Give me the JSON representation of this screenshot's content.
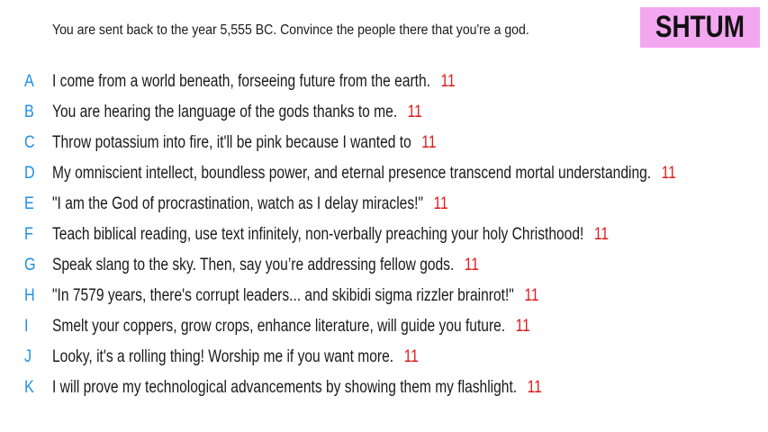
{
  "prompt": "You are sent back to the year 5,555 BC. Convince the people there that you're a god.",
  "brand": {
    "label": "SHTUM",
    "color": "#f4a7f1"
  },
  "colors": {
    "letter": "#1e8fe6",
    "score": "#e01b1b",
    "text": "#1a1a1a"
  },
  "answers": [
    {
      "letter": "A",
      "text": "I come from a world beneath, forseeing future from the earth.",
      "score": "11"
    },
    {
      "letter": "B",
      "text": "You are hearing the language of the gods thanks to me.",
      "score": "11"
    },
    {
      "letter": "C",
      "text": "Throw potassium into fire, it'll be pink because I wanted to",
      "score": "11"
    },
    {
      "letter": "D",
      "text": "My omniscient intellect, boundless power, and eternal presence transcend mortal understanding.",
      "score": "11"
    },
    {
      "letter": "E",
      "text": "\"I am the God of procrastination, watch as I delay miracles!\"",
      "score": "11"
    },
    {
      "letter": "F",
      "text": "Teach biblical reading, use text infinitely, non-verbally preaching your holy Christhood!",
      "score": "11"
    },
    {
      "letter": "G",
      "text": "Speak slang to the sky. Then, say you’re addressing fellow gods.",
      "score": "11"
    },
    {
      "letter": "H",
      "text": "\"In 7579 years, there's corrupt leaders... and skibidi sigma rizzler brainrot!\"",
      "score": "11"
    },
    {
      "letter": "I",
      "text": "Smelt your coppers, grow crops, enhance literature, will guide you future.",
      "score": "11"
    },
    {
      "letter": "J",
      "text": "Looky, it's a rolling thing! Worship me if you want more.",
      "score": "11"
    },
    {
      "letter": "K",
      "text": "I will prove my technological advancements by showing them my flashlight.",
      "score": "11"
    }
  ]
}
